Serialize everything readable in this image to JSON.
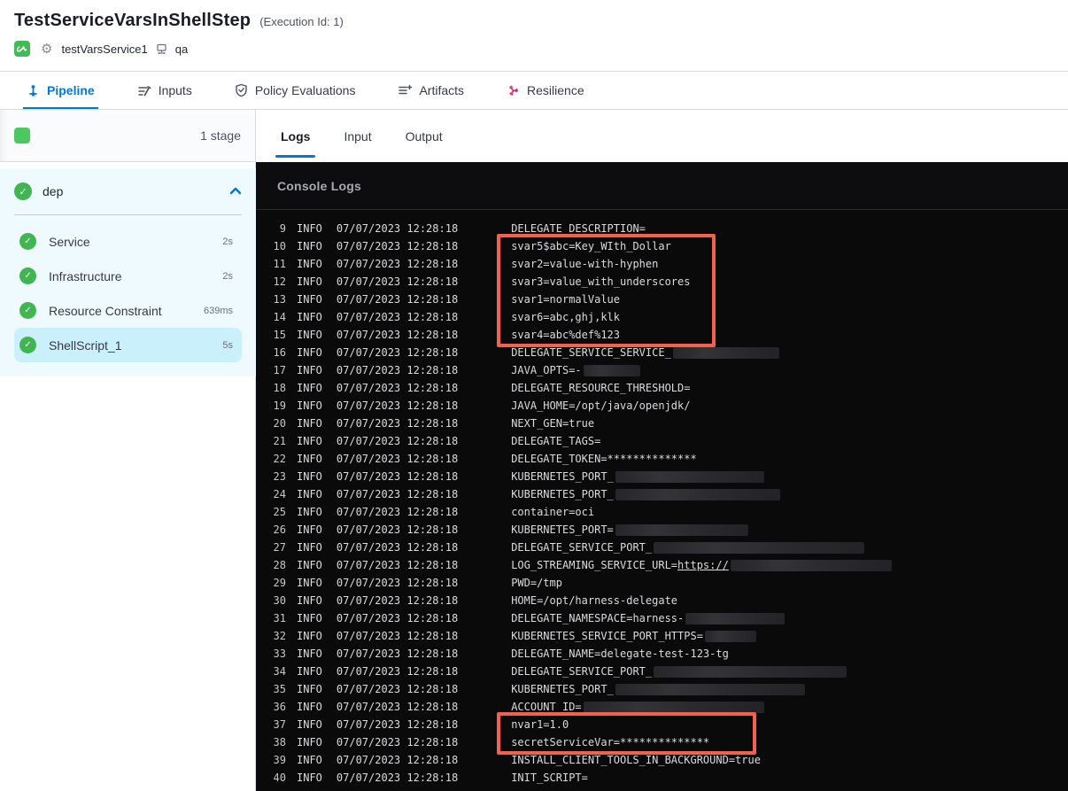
{
  "header": {
    "title": "TestServiceVarsInShellStep",
    "execution_id": "(Execution Id: 1)",
    "service_name": "testVarsService1",
    "environment_name": "qa"
  },
  "module_tabs": [
    {
      "label": "Pipeline",
      "icon": "pipeline-icon",
      "active": true
    },
    {
      "label": "Inputs",
      "icon": "inputs-icon",
      "active": false
    },
    {
      "label": "Policy Evaluations",
      "icon": "policy-shield-icon",
      "active": false
    },
    {
      "label": "Artifacts",
      "icon": "artifacts-icon",
      "active": false
    },
    {
      "label": "Resilience",
      "icon": "resilience-icon",
      "active": false
    }
  ],
  "sidebar": {
    "stage_count": "1 stage",
    "group": {
      "name": "dep",
      "status": "success",
      "expanded": true
    },
    "steps": [
      {
        "name": "Service",
        "duration": "2s",
        "status": "success",
        "selected": false
      },
      {
        "name": "Infrastructure",
        "duration": "2s",
        "status": "success",
        "selected": false
      },
      {
        "name": "Resource Constraint",
        "duration": "639ms",
        "status": "success",
        "selected": false
      },
      {
        "name": "ShellScript_1",
        "duration": "5s",
        "status": "success",
        "selected": true
      }
    ]
  },
  "log_panel": {
    "tabs": [
      {
        "label": "Logs",
        "active": true
      },
      {
        "label": "Input",
        "active": false
      },
      {
        "label": "Output",
        "active": false
      }
    ],
    "console_title": "Console Logs",
    "highlight_color": "#f4604e",
    "lines": [
      {
        "n": 9,
        "level": "INFO",
        "time": "07/07/2023 12:28:18",
        "msg": [
          {
            "t": "DELEGATE_DESCRIPTION="
          }
        ]
      },
      {
        "n": 10,
        "level": "INFO",
        "time": "07/07/2023 12:28:18",
        "hl": "a",
        "msg": [
          {
            "t": "svar5$abc=Key_WIth_Dollar"
          }
        ]
      },
      {
        "n": 11,
        "level": "INFO",
        "time": "07/07/2023 12:28:18",
        "hl": "a",
        "msg": [
          {
            "t": "svar2=value-with-hyphen"
          }
        ]
      },
      {
        "n": 12,
        "level": "INFO",
        "time": "07/07/2023 12:28:18",
        "hl": "a",
        "msg": [
          {
            "t": "svar3=value_with_underscores"
          }
        ]
      },
      {
        "n": 13,
        "level": "INFO",
        "time": "07/07/2023 12:28:18",
        "hl": "a",
        "msg": [
          {
            "t": "svar1=normalValue"
          }
        ]
      },
      {
        "n": 14,
        "level": "INFO",
        "time": "07/07/2023 12:28:18",
        "hl": "a",
        "msg": [
          {
            "t": "svar6=abc,ghj,klk"
          }
        ]
      },
      {
        "n": 15,
        "level": "INFO",
        "time": "07/07/2023 12:28:18",
        "hl": "a",
        "msg": [
          {
            "t": "svar4=abc%def%123"
          }
        ]
      },
      {
        "n": 16,
        "level": "INFO",
        "time": "07/07/2023 12:28:18",
        "msg": [
          {
            "t": "DELEGATE_SERVICE_SERVICE_"
          },
          {
            "r": 120
          }
        ]
      },
      {
        "n": 17,
        "level": "INFO",
        "time": "07/07/2023 12:28:18",
        "msg": [
          {
            "t": "JAVA_OPTS=-"
          },
          {
            "r": 64
          }
        ]
      },
      {
        "n": 18,
        "level": "INFO",
        "time": "07/07/2023 12:28:18",
        "msg": [
          {
            "t": "DELEGATE_RESOURCE_THRESHOLD="
          }
        ]
      },
      {
        "n": 19,
        "level": "INFO",
        "time": "07/07/2023 12:28:18",
        "msg": [
          {
            "t": "JAVA_HOME=/opt/java/openjdk/"
          }
        ]
      },
      {
        "n": 20,
        "level": "INFO",
        "time": "07/07/2023 12:28:18",
        "msg": [
          {
            "t": "NEXT_GEN=true"
          }
        ]
      },
      {
        "n": 21,
        "level": "INFO",
        "time": "07/07/2023 12:28:18",
        "msg": [
          {
            "t": "DELEGATE_TAGS="
          }
        ]
      },
      {
        "n": 22,
        "level": "INFO",
        "time": "07/07/2023 12:28:18",
        "msg": [
          {
            "t": "DELEGATE_TOKEN=**************"
          }
        ]
      },
      {
        "n": 23,
        "level": "INFO",
        "time": "07/07/2023 12:28:18",
        "msg": [
          {
            "t": "KUBERNETES_PORT_"
          },
          {
            "r": 168
          }
        ]
      },
      {
        "n": 24,
        "level": "INFO",
        "time": "07/07/2023 12:28:18",
        "msg": [
          {
            "t": "KUBERNETES_PORT_"
          },
          {
            "r": 186
          }
        ]
      },
      {
        "n": 25,
        "level": "INFO",
        "time": "07/07/2023 12:28:18",
        "msg": [
          {
            "t": "container=oci"
          }
        ]
      },
      {
        "n": 26,
        "level": "INFO",
        "time": "07/07/2023 12:28:18",
        "msg": [
          {
            "t": "KUBERNETES_PORT="
          },
          {
            "r": 150
          }
        ]
      },
      {
        "n": 27,
        "level": "INFO",
        "time": "07/07/2023 12:28:18",
        "msg": [
          {
            "t": "DELEGATE_SERVICE_PORT_"
          },
          {
            "r": 238
          }
        ]
      },
      {
        "n": 28,
        "level": "INFO",
        "time": "07/07/2023 12:28:18",
        "msg": [
          {
            "t": "LOG_STREAMING_SERVICE_URL="
          },
          {
            "l": "https://"
          },
          {
            "r": 182
          }
        ]
      },
      {
        "n": 29,
        "level": "INFO",
        "time": "07/07/2023 12:28:18",
        "msg": [
          {
            "t": "PWD=/tmp"
          }
        ]
      },
      {
        "n": 30,
        "level": "INFO",
        "time": "07/07/2023 12:28:18",
        "msg": [
          {
            "t": "HOME=/opt/harness-delegate"
          }
        ]
      },
      {
        "n": 31,
        "level": "INFO",
        "time": "07/07/2023 12:28:18",
        "msg": [
          {
            "t": "DELEGATE_NAMESPACE=harness-"
          },
          {
            "r": 112
          }
        ]
      },
      {
        "n": 32,
        "level": "INFO",
        "time": "07/07/2023 12:28:18",
        "msg": [
          {
            "t": "KUBERNETES_SERVICE_PORT_HTTPS="
          },
          {
            "r": 58
          }
        ]
      },
      {
        "n": 33,
        "level": "INFO",
        "time": "07/07/2023 12:28:18",
        "msg": [
          {
            "t": "DELEGATE_NAME=delegate-test-123-tg"
          }
        ]
      },
      {
        "n": 34,
        "level": "INFO",
        "time": "07/07/2023 12:28:18",
        "msg": [
          {
            "t": "DELEGATE_SERVICE_PORT_"
          },
          {
            "r": 218
          }
        ]
      },
      {
        "n": 35,
        "level": "INFO",
        "time": "07/07/2023 12:28:18",
        "msg": [
          {
            "t": "KUBERNETES_PORT_"
          },
          {
            "r": 214
          }
        ]
      },
      {
        "n": 36,
        "level": "INFO",
        "time": "07/07/2023 12:28:18",
        "msg": [
          {
            "t": "ACCOUNT_ID="
          },
          {
            "r": 204
          }
        ]
      },
      {
        "n": 37,
        "level": "INFO",
        "time": "07/07/2023 12:28:18",
        "hl": "b",
        "msg": [
          {
            "t": "nvar1=1.0"
          }
        ]
      },
      {
        "n": 38,
        "level": "INFO",
        "time": "07/07/2023 12:28:18",
        "hl": "b",
        "msg": [
          {
            "t": "secretServiceVar=**************"
          }
        ]
      },
      {
        "n": 39,
        "level": "INFO",
        "time": "07/07/2023 12:28:18",
        "msg": [
          {
            "t": "INSTALL_CLIENT_TOOLS_IN_BACKGROUND=true"
          }
        ]
      },
      {
        "n": 40,
        "level": "INFO",
        "time": "07/07/2023 12:28:18",
        "msg": [
          {
            "t": "INIT_SCRIPT="
          }
        ]
      }
    ]
  },
  "colors": {
    "accent_blue": "#0278d5",
    "success_green": "#42b553",
    "stage_green": "#4dc75f",
    "resilience_pink": "#e9398b",
    "highlight_red": "#f4604e",
    "console_bg": "#0a0a0b",
    "border": "#d9dae5",
    "panel_cyan": "#eefafd",
    "selected_step_cyan": "#c9f0fb"
  }
}
